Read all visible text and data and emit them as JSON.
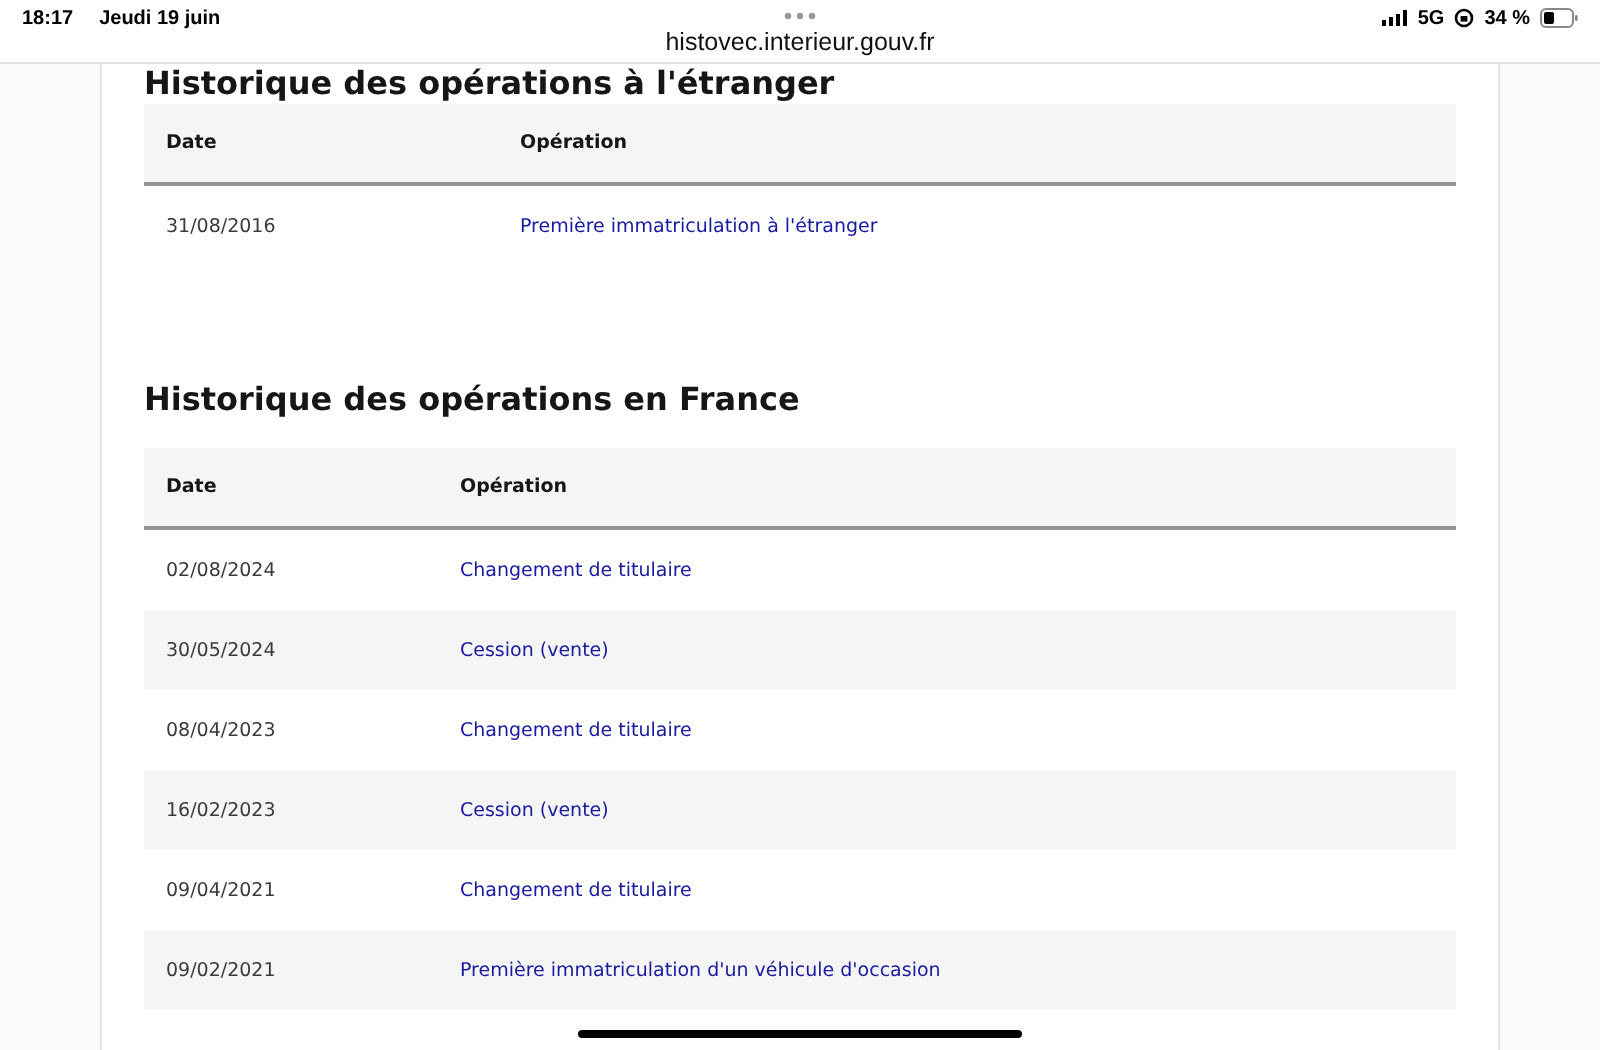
{
  "status_bar": {
    "time": "18:17",
    "date": "Jeudi 19 juin",
    "url": "histovec.interieur.gouv.fr",
    "network": "5G",
    "battery": "34 %"
  },
  "sections": [
    {
      "title": "Historique des opérations à l'étranger",
      "columns": [
        "Date",
        "Opération"
      ],
      "rows": [
        {
          "date": "31/08/2016",
          "operation": "Première immatriculation à l'étranger"
        }
      ]
    },
    {
      "title": "Historique des opérations en France",
      "columns": [
        "Date",
        "Opération"
      ],
      "rows": [
        {
          "date": "02/08/2024",
          "operation": "Changement de titulaire"
        },
        {
          "date": "30/05/2024",
          "operation": "Cession (vente)"
        },
        {
          "date": "08/04/2023",
          "operation": "Changement de titulaire"
        },
        {
          "date": "16/02/2023",
          "operation": "Cession (vente)"
        },
        {
          "date": "09/04/2021",
          "operation": "Changement de titulaire"
        },
        {
          "date": "09/02/2021",
          "operation": "Première immatriculation d'un véhicule d'occasion"
        }
      ]
    }
  ]
}
